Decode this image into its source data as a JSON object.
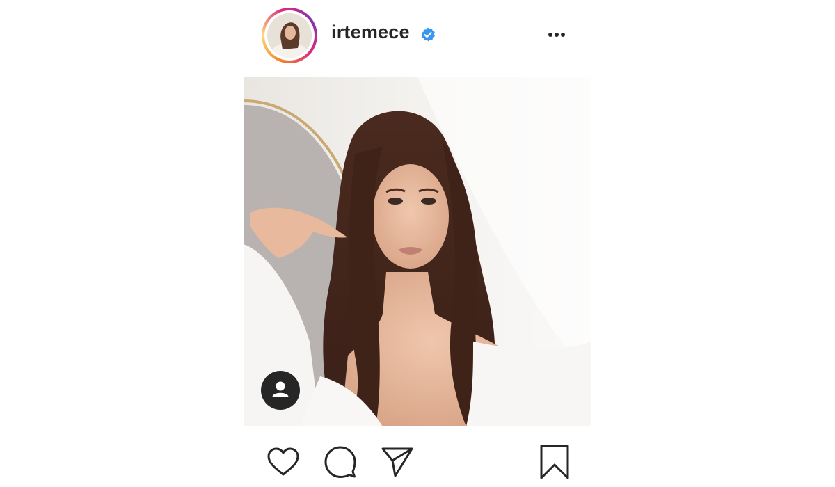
{
  "post": {
    "username": "irtemece",
    "verified": true
  },
  "icons": {
    "avatar": "avatar-icon",
    "verified": "verified-badge-icon",
    "more": "more-options-icon",
    "tag": "user-tag-icon",
    "like": "heart-icon",
    "comment": "comment-icon",
    "share": "paper-plane-icon",
    "save": "bookmark-icon"
  },
  "colors": {
    "text": "#262626",
    "verified_blue": "#3897f0",
    "tag_button": "#262626"
  }
}
